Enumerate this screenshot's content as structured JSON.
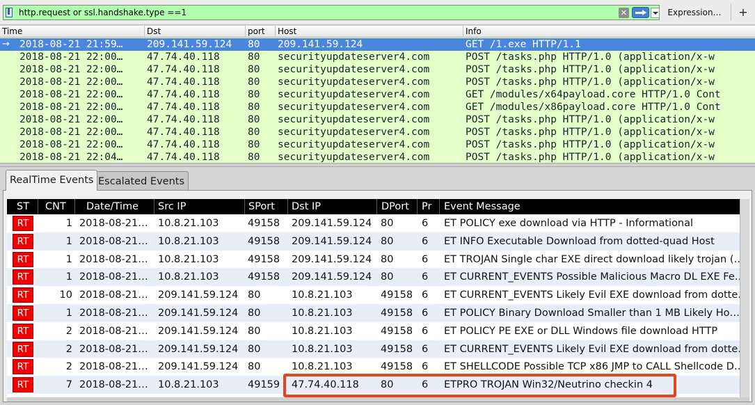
{
  "filter": {
    "value": "http.request or ssl.handshake.type ==1",
    "clear_icon": "clear-icon",
    "apply_icon": "apply-arrow-icon",
    "expression_label": "Expression…",
    "add_label": "+"
  },
  "packet_list": {
    "columns": [
      "Time",
      "Dst",
      "port",
      "Host",
      "Info"
    ],
    "rows": [
      {
        "time": "2018-08-21 21:59…",
        "dst": "209.141.59.124",
        "port": "80",
        "host": "209.141.59.124",
        "info": "GET /1.exe HTTP/1.1"
      },
      {
        "time": "2018-08-21 22:00…",
        "dst": "47.74.40.118",
        "port": "80",
        "host": "securityupdateserver4.com",
        "info": "POST /tasks.php HTTP/1.0  (application/x-w"
      },
      {
        "time": "2018-08-21 22:00…",
        "dst": "47.74.40.118",
        "port": "80",
        "host": "securityupdateserver4.com",
        "info": "POST /tasks.php HTTP/1.0  (application/x-w"
      },
      {
        "time": "2018-08-21 22:00…",
        "dst": "47.74.40.118",
        "port": "80",
        "host": "securityupdateserver4.com",
        "info": "POST /tasks.php HTTP/1.0  (application/x-w"
      },
      {
        "time": "2018-08-21 22:00…",
        "dst": "47.74.40.118",
        "port": "80",
        "host": "securityupdateserver4.com",
        "info": "GET /modules/x64payload.core HTTP/1.0 Cont"
      },
      {
        "time": "2018-08-21 22:00…",
        "dst": "47.74.40.118",
        "port": "80",
        "host": "securityupdateserver4.com",
        "info": "GET /modules/x86payload.core HTTP/1.0 Cont"
      },
      {
        "time": "2018-08-21 22:00…",
        "dst": "47.74.40.118",
        "port": "80",
        "host": "securityupdateserver4.com",
        "info": "POST /tasks.php HTTP/1.0  (application/x-w"
      },
      {
        "time": "2018-08-21 22:00…",
        "dst": "47.74.40.118",
        "port": "80",
        "host": "securityupdateserver4.com",
        "info": "POST /tasks.php HTTP/1.0  (application/x-w"
      },
      {
        "time": "2018-08-21 22:00…",
        "dst": "47.74.40.118",
        "port": "80",
        "host": "securityupdateserver4.com",
        "info": "POST /tasks.php HTTP/1.0  (application/x-w"
      },
      {
        "time": "2018-08-21 22:04…",
        "dst": "47.74.40.118",
        "port": "80",
        "host": "securityupdateserver4.com",
        "info": "POST /tasks.php HTTP/1.0  (application/x-w"
      }
    ]
  },
  "events": {
    "tabs": [
      "RealTime Events",
      "Escalated Events"
    ],
    "columns": [
      "ST",
      "CNT",
      "Date/Time",
      "Src IP",
      "SPort",
      "Dst IP",
      "DPort",
      "Pr",
      "Event Message"
    ],
    "rows": [
      {
        "st": "RT",
        "cnt": "1",
        "datetime": "2018-08-21…",
        "src": "10.8.21.103",
        "sport": "49158",
        "dst": "209.141.59.124",
        "dport": "80",
        "pr": "6",
        "msg": "ET POLICY exe download via HTTP - Informational"
      },
      {
        "st": "RT",
        "cnt": "1",
        "datetime": "2018-08-21…",
        "src": "10.8.21.103",
        "sport": "49158",
        "dst": "209.141.59.124",
        "dport": "80",
        "pr": "6",
        "msg": "ET INFO Executable Download from dotted-quad Host"
      },
      {
        "st": "RT",
        "cnt": "1",
        "datetime": "2018-08-21…",
        "src": "10.8.21.103",
        "sport": "49158",
        "dst": "209.141.59.124",
        "dport": "80",
        "pr": "6",
        "msg": "ET TROJAN Single char EXE direct download likely trojan (…"
      },
      {
        "st": "RT",
        "cnt": "1",
        "datetime": "2018-08-21…",
        "src": "10.8.21.103",
        "sport": "49158",
        "dst": "209.141.59.124",
        "dport": "80",
        "pr": "6",
        "msg": "ET CURRENT_EVENTS Possible Malicious Macro DL EXE Fe…"
      },
      {
        "st": "RT",
        "cnt": "10",
        "datetime": "2018-08-21…",
        "src": "209.141.59.124",
        "sport": "80",
        "dst": "10.8.21.103",
        "dport": "49158",
        "pr": "6",
        "msg": "ET CURRENT_EVENTS Likely Evil EXE download from dotte…"
      },
      {
        "st": "RT",
        "cnt": "1",
        "datetime": "2018-08-21…",
        "src": "209.141.59.124",
        "sport": "80",
        "dst": "10.8.21.103",
        "dport": "49158",
        "pr": "6",
        "msg": "ET POLICY Binary Download Smaller than 1 MB Likely Ho…"
      },
      {
        "st": "RT",
        "cnt": "2",
        "datetime": "2018-08-21…",
        "src": "209.141.59.124",
        "sport": "80",
        "dst": "10.8.21.103",
        "dport": "49158",
        "pr": "6",
        "msg": "ET POLICY PE EXE or DLL Windows file download HTTP"
      },
      {
        "st": "RT",
        "cnt": "2",
        "datetime": "2018-08-21…",
        "src": "209.141.59.124",
        "sport": "80",
        "dst": "10.8.21.103",
        "dport": "49158",
        "pr": "6",
        "msg": "ET CURRENT_EVENTS Likely Evil EXE download from dotte…"
      },
      {
        "st": "RT",
        "cnt": "2",
        "datetime": "2018-08-21…",
        "src": "209.141.59.124",
        "sport": "80",
        "dst": "10.8.21.103",
        "dport": "49158",
        "pr": "6",
        "msg": "ET SHELLCODE Possible TCP x86 JMP to CALL Shellcode D…"
      },
      {
        "st": "RT",
        "cnt": "7",
        "datetime": "2018-08-21…",
        "src": "10.8.21.103",
        "sport": "49159",
        "dst": "47.74.40.118",
        "dport": "80",
        "pr": "6",
        "msg": "ETPRO TROJAN Win32/Neutrino checkin 4"
      }
    ]
  },
  "colors": {
    "filter_valid": "#afffaf",
    "packet_row_bg": "#e4ffc7",
    "selected_row": "#4a86de",
    "st_badge": "#f20000",
    "highlight": "#e2451f"
  }
}
